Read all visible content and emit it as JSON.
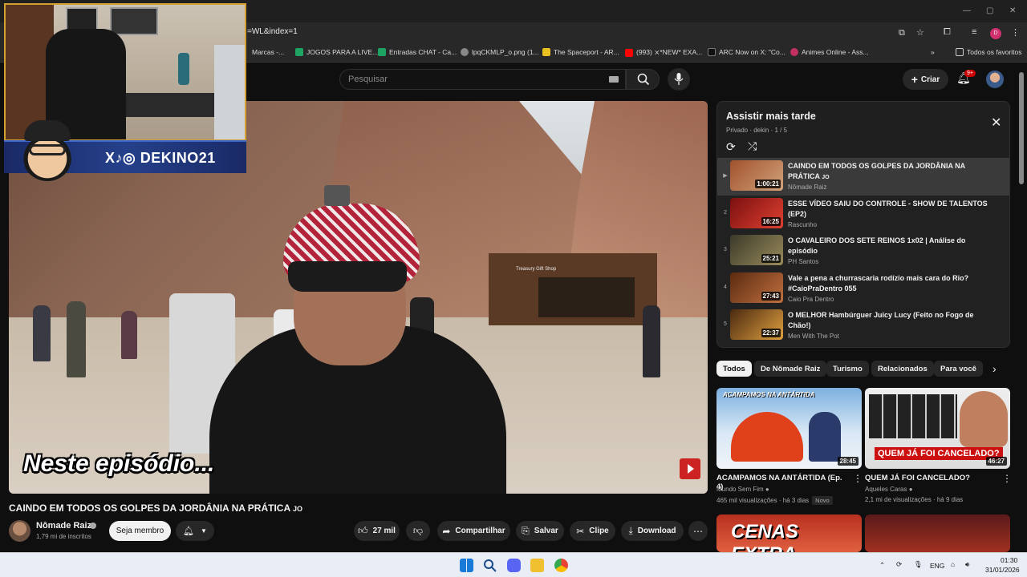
{
  "browser": {
    "url_fragment": "=WL&index=1",
    "bookmarks": [
      {
        "label": "Marcas -...",
        "color": "#555555"
      },
      {
        "label": "JOGOS PARA A LIVE...",
        "color": "#1ea362"
      },
      {
        "label": "Entradas CHAT - Ca...",
        "color": "#1ea362"
      },
      {
        "label": "lpqCKMLP_o.png (1...",
        "color": "#888888"
      },
      {
        "label": "The Spaceport - AR...",
        "color": "#e8c020"
      },
      {
        "label": "(993) ⨯*NEW* EXA...",
        "color": "#ff0000"
      },
      {
        "label": "ARC Now on X: \"Co...",
        "color": "#111111"
      },
      {
        "label": "Animes Online - Ass...",
        "color": "#c03060"
      }
    ],
    "all_favorites": "Todos os favoritos"
  },
  "header": {
    "search_placeholder": "Pesquisar",
    "create_label": "Criar",
    "notif_badge": "9+"
  },
  "player": {
    "caption": "Neste episódio...",
    "shop_sign": "Treasury Gift Shop"
  },
  "overlay": {
    "social_handle": "DEKINO21",
    "social_icons": "X♪◎"
  },
  "video": {
    "title": "CAINDO EM TODOS OS GOLPES DA JORDÂNIA NA PRÁTICA",
    "title_suffix": "JO",
    "channel": "Nômade Raiz",
    "subscribers": "1,79 mi de inscritos",
    "member_button": "Seja membro",
    "actions": {
      "likes": "27 mil",
      "share": "Compartilhar",
      "save": "Salvar",
      "clip": "Clipe",
      "download": "Download"
    }
  },
  "playlist": {
    "title": "Assistir mais tarde",
    "meta": "Privado · dekin · 1 / 5",
    "items": [
      {
        "index": "▶",
        "title": "CAINDO EM TODOS OS GOLPES DA JORDÂNIA NA PRÁTICA",
        "suffix": "JO",
        "channel": "Nômade Raiz",
        "duration": "1:00:21",
        "c1": "#a0522d",
        "c2": "#d2a27a"
      },
      {
        "index": "2",
        "title": "ESSE VÍDEO SAIU DO CONTROLE - SHOW DE TALENTOS (EP2)",
        "suffix": "",
        "channel": "Rascunho",
        "duration": "16:25",
        "c1": "#7a1010",
        "c2": "#e04030"
      },
      {
        "index": "3",
        "title": "O CAVALEIRO DOS SETE REINOS 1x02 | Análise do episódio",
        "suffix": "",
        "channel": "PH Santos",
        "duration": "25:21",
        "c1": "#3a3a2a",
        "c2": "#9a8a5a"
      },
      {
        "index": "4",
        "title": "Vale a pena a churrascaria rodízio mais cara do Rio? #CaioPraDentro 055",
        "suffix": "",
        "channel": "Caio Pra Dentro",
        "duration": "27:43",
        "c1": "#5a2a10",
        "c2": "#c07040"
      },
      {
        "index": "5",
        "title": "O MELHOR Hambúrguer Juicy Lucy (Feito no Fogo de Chão!)",
        "suffix": "",
        "channel": "Men With The Pot",
        "duration": "22:37",
        "c1": "#4a2a10",
        "c2": "#e0a040"
      }
    ]
  },
  "chips": [
    "Todos",
    "De Nômade Raiz",
    "Turismo",
    "Relacionados",
    "Para você"
  ],
  "recommendations": [
    {
      "title": "ACAMPAMOS NA ANTÁRTIDA (Ep. 4)",
      "channel": "Mundo Sem Fim",
      "views": "465 mil visualizações",
      "age": "há 3 dias",
      "badge": "Novo",
      "duration": "28:45",
      "thumb_text": "ACAMPAMOS NA ANTÁRTIDA"
    },
    {
      "title": "QUEM JÁ FOI CANCELADO?",
      "channel": "Aqueles Caras",
      "views": "2,1 mi de visualizações",
      "age": "há 9 dias",
      "badge": "",
      "duration": "46:27",
      "thumb_text": "QUEM JÁ FOI CANCELADO?"
    },
    {
      "title": "",
      "channel": "",
      "views": "",
      "age": "",
      "badge": "",
      "duration": "",
      "thumb_text": "CENAS EXTRA"
    },
    {
      "title": "",
      "channel": "",
      "views": "",
      "age": "",
      "badge": "",
      "duration": "",
      "thumb_text": ""
    }
  ],
  "taskbar": {
    "lang": "ENG",
    "time": "01:30",
    "date": "31/01/2026"
  }
}
